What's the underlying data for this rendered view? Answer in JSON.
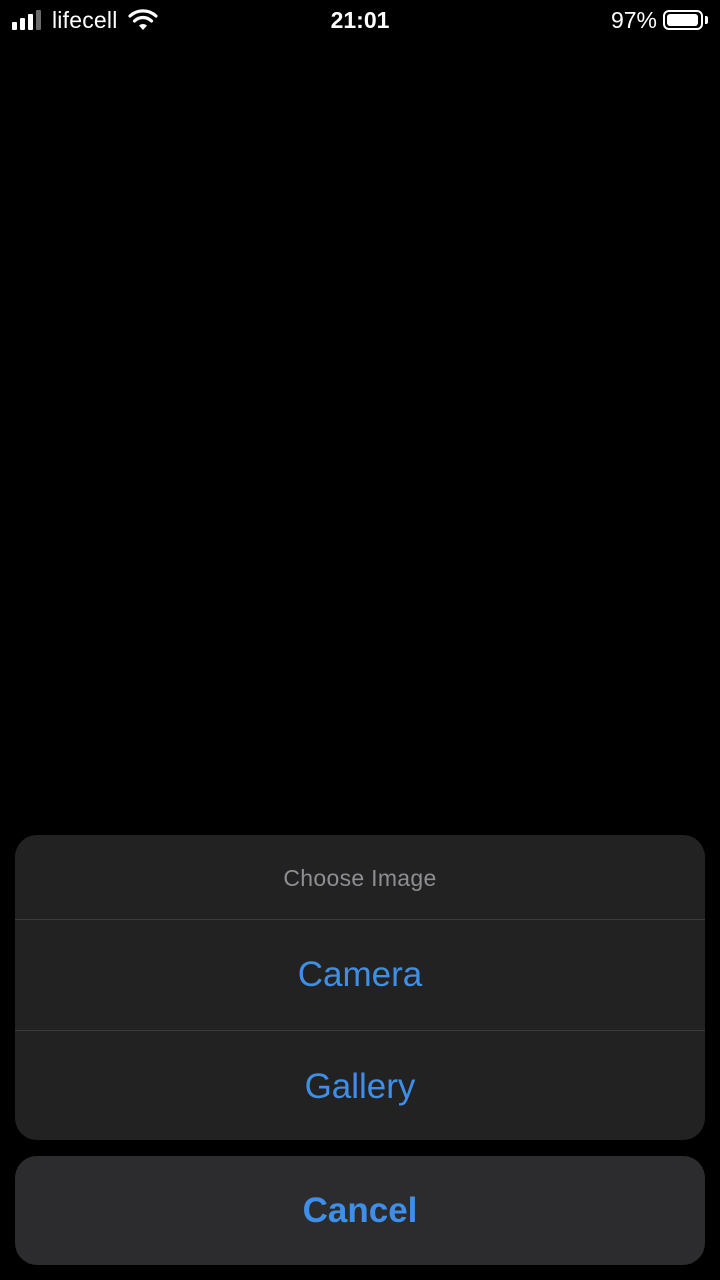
{
  "status_bar": {
    "carrier": "lifecell",
    "time": "21:01",
    "battery_percent": "97%",
    "battery_level": 0.97,
    "signal_bars_active": 3,
    "signal_bars_total": 4,
    "icons": [
      "signal-icon",
      "wifi-icon",
      "battery-icon"
    ]
  },
  "action_sheet": {
    "title": "Choose Image",
    "actions": [
      {
        "label": "Camera"
      },
      {
        "label": "Gallery"
      }
    ],
    "cancel_label": "Cancel"
  },
  "colors": {
    "background": "#000000",
    "sheet_background": "#222222",
    "cancel_background": "#2c2c2e",
    "accent": "#3f8fe8",
    "title_text": "#8e8e93"
  }
}
